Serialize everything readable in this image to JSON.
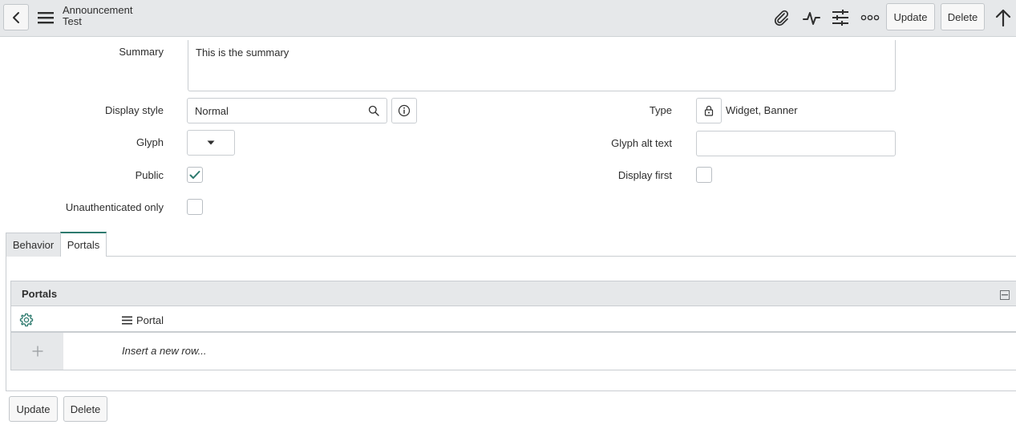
{
  "header": {
    "title": "Announcement",
    "subtitle": "Test",
    "update_label": "Update",
    "delete_label": "Delete"
  },
  "form": {
    "summary_label": "Summary",
    "summary_value": "This is the summary",
    "display_style_label": "Display style",
    "display_style_value": "Normal",
    "type_label": "Type",
    "type_value": "Widget, Banner",
    "glyph_label": "Glyph",
    "glyph_alt_label": "Glyph alt text",
    "glyph_alt_value": "",
    "public_label": "Public",
    "public_checked": true,
    "display_first_label": "Display first",
    "display_first_checked": false,
    "unauth_label": "Unauthenticated only",
    "unauth_checked": false
  },
  "tabs": [
    {
      "label": "Behavior",
      "active": false
    },
    {
      "label": "Portals",
      "active": true
    }
  ],
  "related_list": {
    "title": "Portals",
    "column": "Portal",
    "insert_text": "Insert a new row..."
  },
  "footer": {
    "update_label": "Update",
    "delete_label": "Delete"
  },
  "colors": {
    "accent": "#2d7a6e",
    "header_bg": "#e6e8ea"
  },
  "icons": [
    "chevron-left-icon",
    "menu-icon",
    "paperclip-icon",
    "activity-icon",
    "sliders-icon",
    "more-icon",
    "arrow-up-icon",
    "search-icon",
    "info-icon",
    "lock-icon",
    "caret-down-icon",
    "check-icon",
    "gear-icon",
    "list-icon",
    "collapse-icon",
    "plus-icon"
  ]
}
